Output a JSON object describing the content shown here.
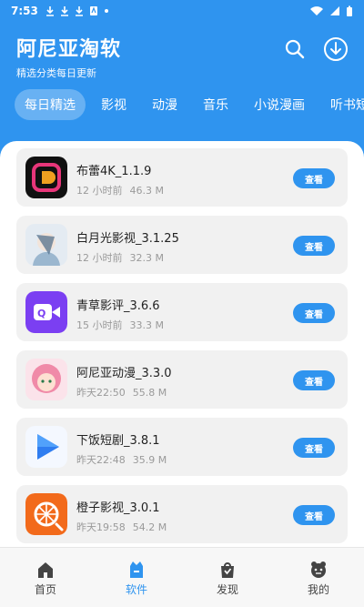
{
  "status": {
    "time": "7:53"
  },
  "header": {
    "title": "阿尼亚淘软",
    "subtitle": "精选分类每日更新"
  },
  "tabs": [
    {
      "label": "每日精选",
      "active": true
    },
    {
      "label": "影视"
    },
    {
      "label": "动漫"
    },
    {
      "label": "音乐"
    },
    {
      "label": "小说漫画"
    },
    {
      "label": "听书短剧"
    }
  ],
  "apps": [
    {
      "name": "布蕾4K_1.1.9",
      "time": "12 小时前",
      "size": "46.3 M",
      "icon": "bulei-icon",
      "color": "#111111"
    },
    {
      "name": "白月光影视_3.1.25",
      "time": "12 小时前",
      "size": "32.3 M",
      "icon": "baiyueguang-icon",
      "color": "#cfd8e3"
    },
    {
      "name": "青草影评_3.6.6",
      "time": "15 小时前",
      "size": "33.3 M",
      "icon": "qingcao-icon",
      "color": "#7b3ff2"
    },
    {
      "name": "阿尼亚动漫_3.3.0",
      "time": "昨天22:50",
      "size": "55.8 M",
      "icon": "aniya-icon",
      "color": "#f6b6c8"
    },
    {
      "name": "下饭短剧_3.8.1",
      "time": "昨天22:48",
      "size": "35.9 M",
      "icon": "xiafan-icon",
      "color": "#2f7df0"
    },
    {
      "name": "橙子影视_3.0.1",
      "time": "昨天19:58",
      "size": "54.2 M",
      "icon": "chengzi-icon",
      "color": "#f26a1b"
    }
  ],
  "view_label": "查看",
  "nav": [
    {
      "label": "首页",
      "icon": "home-icon"
    },
    {
      "label": "软件",
      "icon": "software-icon",
      "active": true
    },
    {
      "label": "发现",
      "icon": "discover-icon"
    },
    {
      "label": "我的",
      "icon": "profile-icon"
    }
  ]
}
